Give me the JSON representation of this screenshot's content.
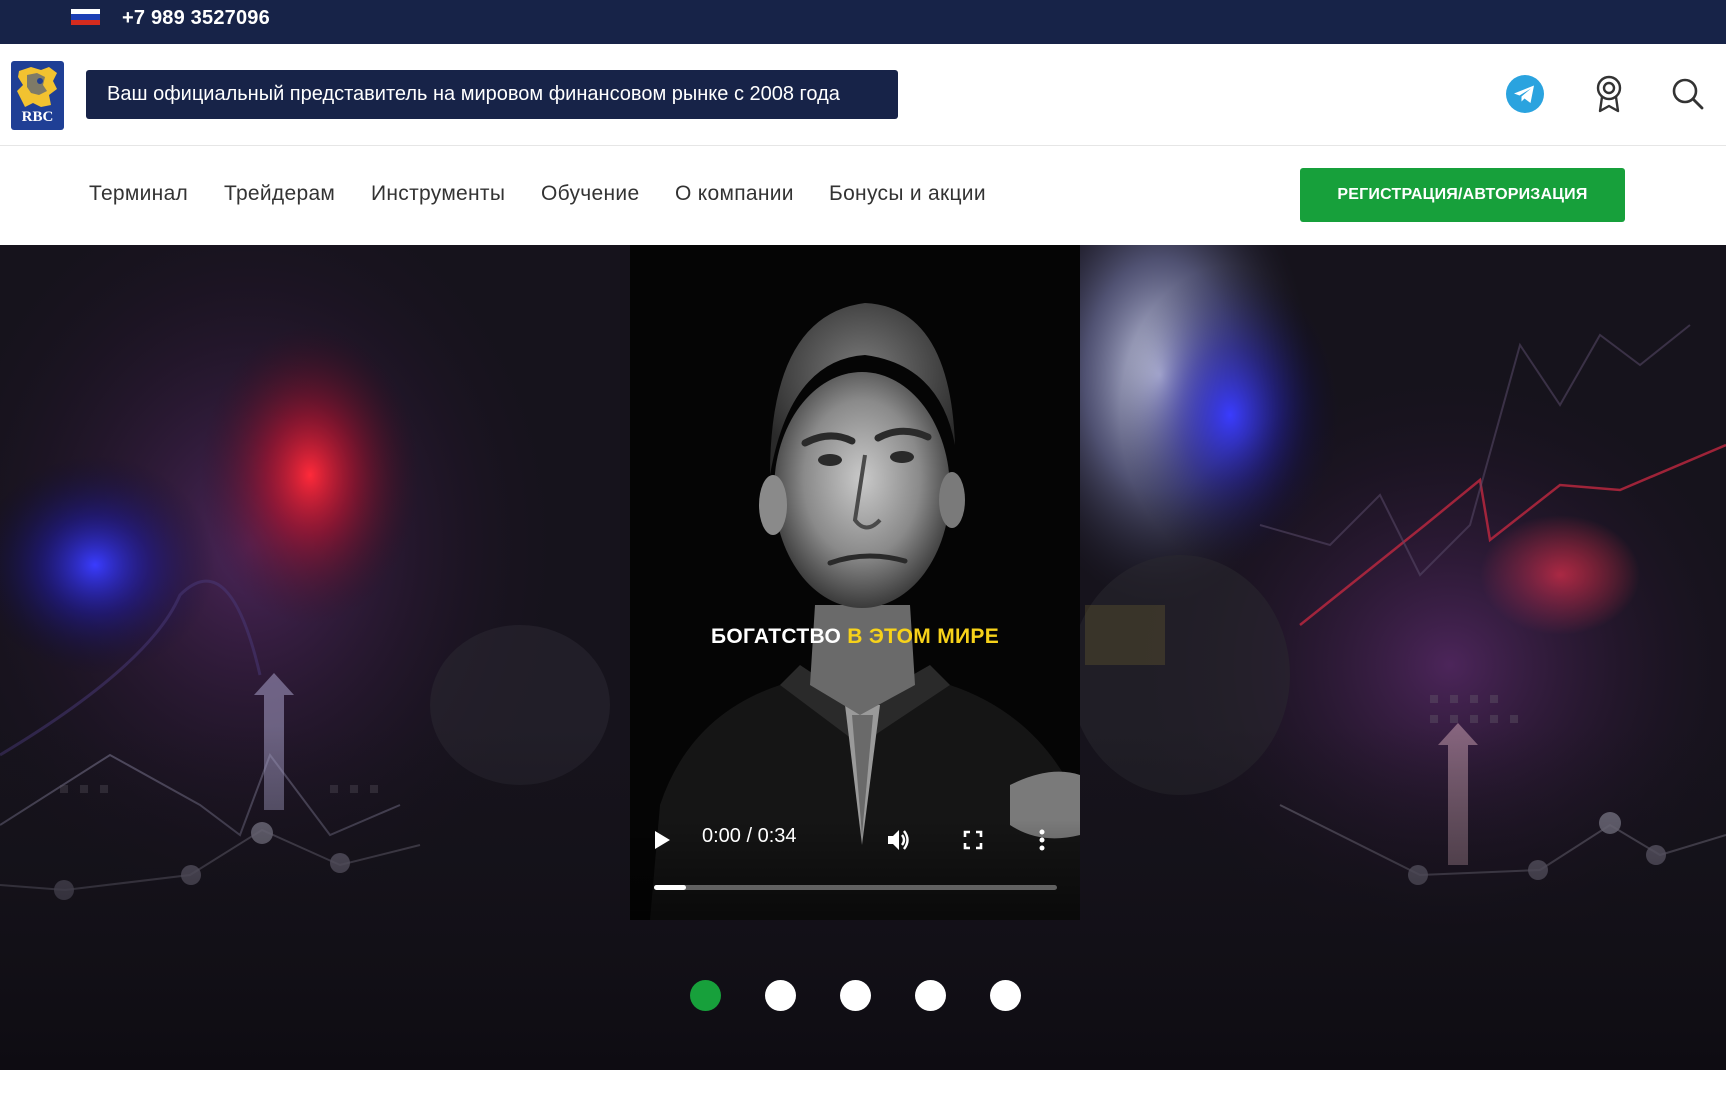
{
  "topbar": {
    "phone": "+7 989 3527096",
    "flag_icon": "russia-flag-icon"
  },
  "header": {
    "logo_text": "RBC",
    "tagline": "Ваш официальный представитель на мировом финансовом рынке с 2008 года",
    "icons": [
      "telegram-icon",
      "award-icon",
      "search-icon"
    ]
  },
  "nav": {
    "items": [
      {
        "label": "Терминал"
      },
      {
        "label": "Трейдерам"
      },
      {
        "label": "Инструменты"
      },
      {
        "label": "Обучение"
      },
      {
        "label": "О компании"
      },
      {
        "label": "Бонусы и акции"
      }
    ],
    "register_label": "РЕГИСТРАЦИЯ/АВТОРИЗАЦИЯ"
  },
  "hero": {
    "video": {
      "caption_white": "БОГАТСТВО",
      "caption_yellow": "В ЭТОМ МИРЕ",
      "time": "0:00 / 0:34",
      "progress": 0.08
    },
    "slides_count": 5,
    "active_slide": 0
  },
  "colors": {
    "navy": "#172348",
    "green": "#17a03b",
    "caption_yellow": "#f7d21a",
    "telegram": "#2aa3df"
  }
}
